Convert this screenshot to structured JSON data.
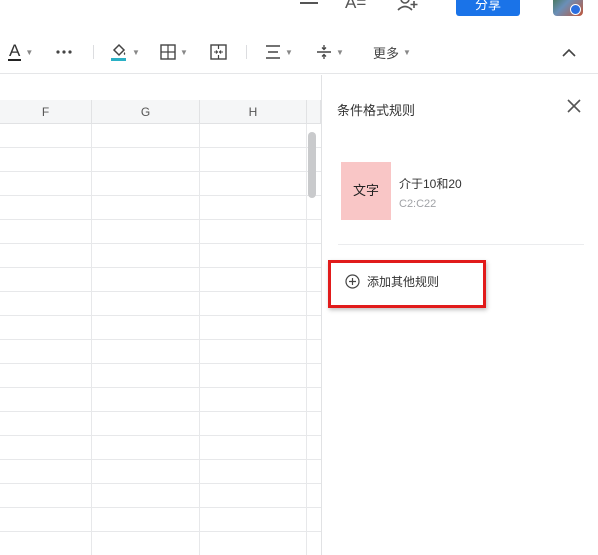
{
  "header": {
    "share_label": "分享",
    "font_size_icon_label": "A="
  },
  "toolbar": {
    "font_color_label": "A",
    "more_label": "更多"
  },
  "grid": {
    "columns": [
      "F",
      "G",
      "H"
    ]
  },
  "panel": {
    "title": "条件格式规则",
    "rules": [
      {
        "preview_text": "文字",
        "preview_bg": "#f9c6c6",
        "description": "介于10和20",
        "range": "C2:C22"
      }
    ],
    "add_rule_label": "添加其他规则"
  },
  "colors": {
    "accent": "#1a73e8",
    "highlight_border": "#e11b1b",
    "fill_color_bar": "#2ab0c5"
  },
  "icons": [
    "menu-icon",
    "font-size-icon",
    "add-user-icon",
    "font-color-icon",
    "more-dots-icon",
    "fill-color-icon",
    "border-icon",
    "merge-cells-icon",
    "align-icon",
    "vertical-align-icon",
    "chevron-up-icon",
    "close-icon",
    "plus-circle-icon"
  ]
}
